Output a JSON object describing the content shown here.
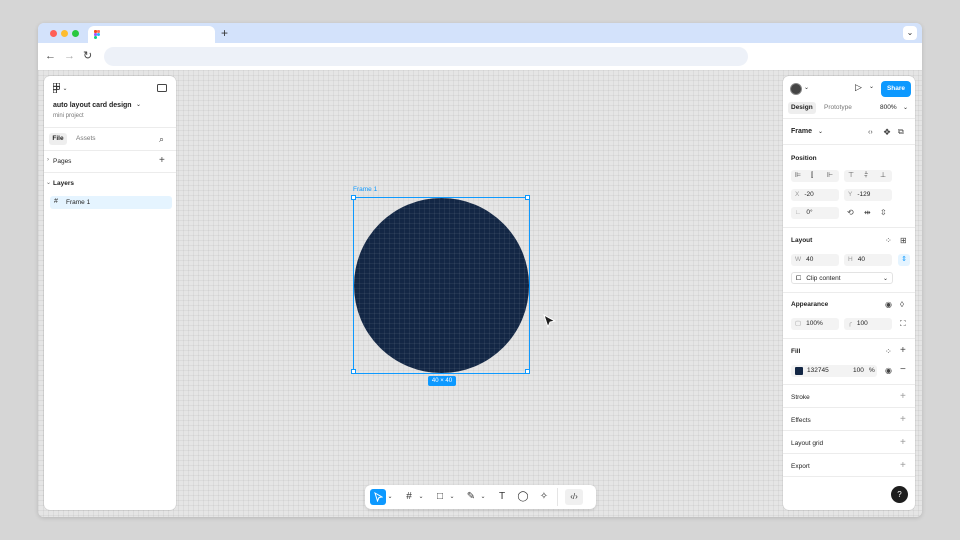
{
  "browser": {
    "tab_title": "",
    "new_tab": "+",
    "address": ""
  },
  "left_panel": {
    "file_name": "auto layout card design",
    "project_name": "mini project",
    "tabs": [
      "File",
      "Assets"
    ],
    "pages_label": "Pages",
    "layers_label": "Layers",
    "layers": [
      {
        "name": "Frame 1"
      }
    ]
  },
  "canvas": {
    "frame_label": "Frame 1",
    "size_badge": "40 × 40",
    "circle_color": "#132745",
    "selection_color": "#0d99ff"
  },
  "right_panel": {
    "share_label": "Share",
    "tabs": [
      "Design",
      "Prototype"
    ],
    "zoom": "800%",
    "frame_dropdown": "Frame",
    "position": {
      "title": "Position",
      "x_label": "X",
      "x": "-20",
      "y_label": "Y",
      "y": "-129",
      "rotation": "0°"
    },
    "layout": {
      "title": "Layout",
      "w_label": "W",
      "w": "40",
      "h_label": "H",
      "h": "40",
      "clip_content": "Clip content"
    },
    "appearance": {
      "title": "Appearance",
      "opacity": "100%",
      "radius": "100"
    },
    "fill": {
      "title": "Fill",
      "hex": "132745",
      "opacity": "100",
      "unit": "%"
    },
    "stroke": "Stroke",
    "effects": "Effects",
    "layout_grid": "Layout grid",
    "export": "Export",
    "help": "?"
  },
  "colors": {
    "accent": "#0d99ff",
    "circle": "#132745"
  }
}
